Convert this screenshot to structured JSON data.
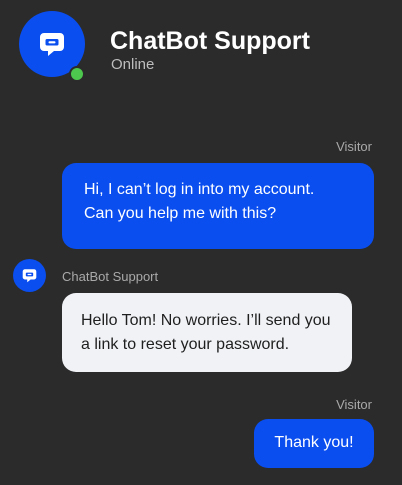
{
  "header": {
    "title": "ChatBot Support",
    "status": "Online",
    "avatar_icon": "chat-bubble-icon",
    "status_color": "#4ec74e"
  },
  "colors": {
    "background": "#2b2b2b",
    "accent": "#0a4ef0",
    "bot_bubble": "#f0f2f6"
  },
  "messages": [
    {
      "sender": "Visitor",
      "lines": [
        "Hi, I can’t log in into my account.",
        "Can you help me with this?"
      ]
    },
    {
      "sender": "ChatBot Support",
      "lines": [
        "Hello Tom! No worries. I’ll send you",
        "a link to reset your password."
      ],
      "avatar_icon": "chat-bubble-icon"
    },
    {
      "sender": "Visitor",
      "lines": [
        "Thank you!"
      ]
    }
  ]
}
